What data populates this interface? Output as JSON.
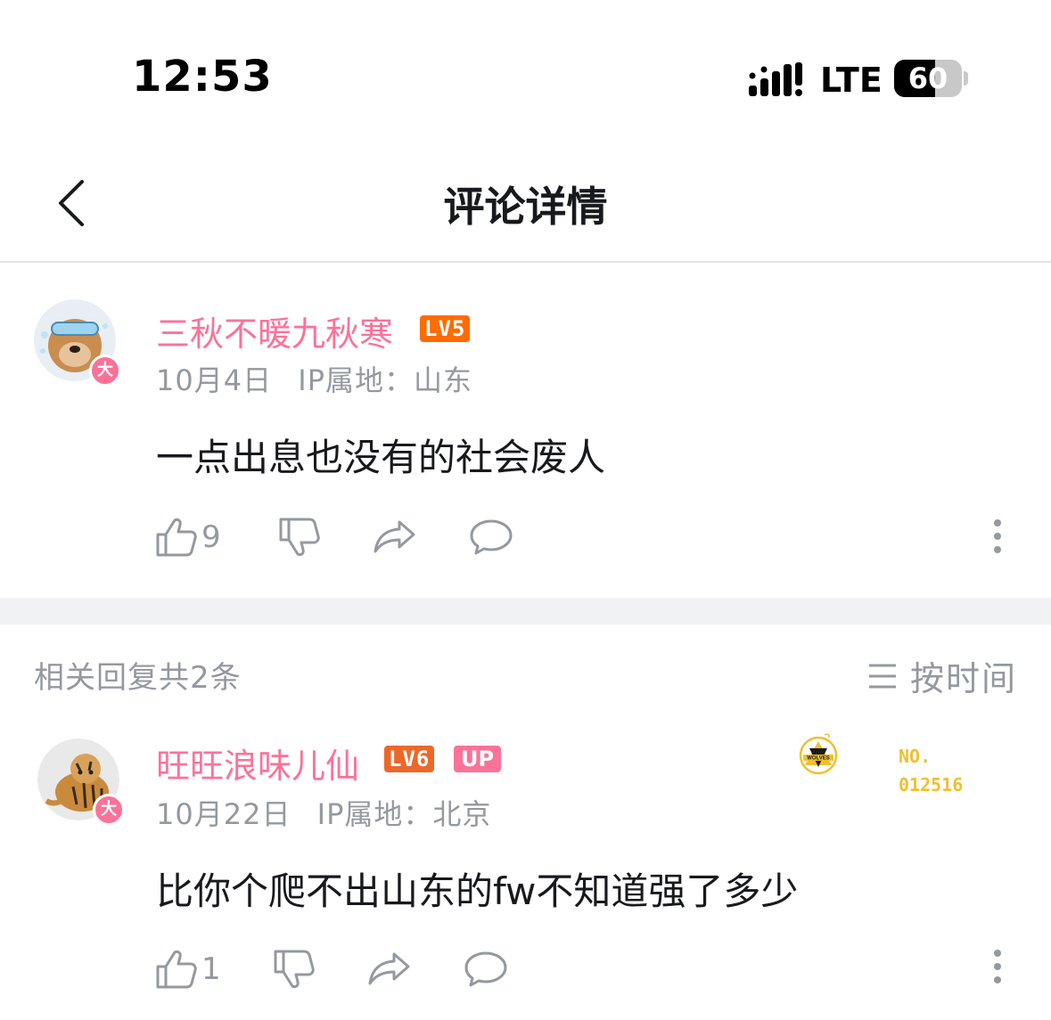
{
  "status_bar": {
    "time": "12:53",
    "network": "LTE",
    "battery_level": 60,
    "battery_text": "60"
  },
  "header": {
    "title": "评论详情",
    "back_icon": "chevron-left-icon"
  },
  "main_comment": {
    "username": "三秋不暖九秋寒",
    "level": "LV5",
    "level_color": "#ff6c00",
    "avatar_badge": "大",
    "date": "10月4日",
    "ip_location": "IP属地：山东",
    "text": "一点出息也没有的社会废人",
    "like_count": "9"
  },
  "replies": {
    "count_label": "相关回复共2条",
    "sort_label": "按时间"
  },
  "reply_1": {
    "username": "旺旺浪味儿仙",
    "level": "LV6",
    "level_color": "#ee672a",
    "up_badge": "UP",
    "avatar_badge": "大",
    "date": "10月22日",
    "ip_location": "IP属地：北京",
    "text": "比你个爬不出山东的fw不知道强了多少",
    "like_count": "1",
    "medal_text": "WOLVES",
    "medal_no_label": "NO.",
    "medal_no": "012516"
  },
  "colors": {
    "accent_pink": "#fb7299",
    "muted_gray": "#9499a0",
    "medal_gold": "#f0c030"
  }
}
